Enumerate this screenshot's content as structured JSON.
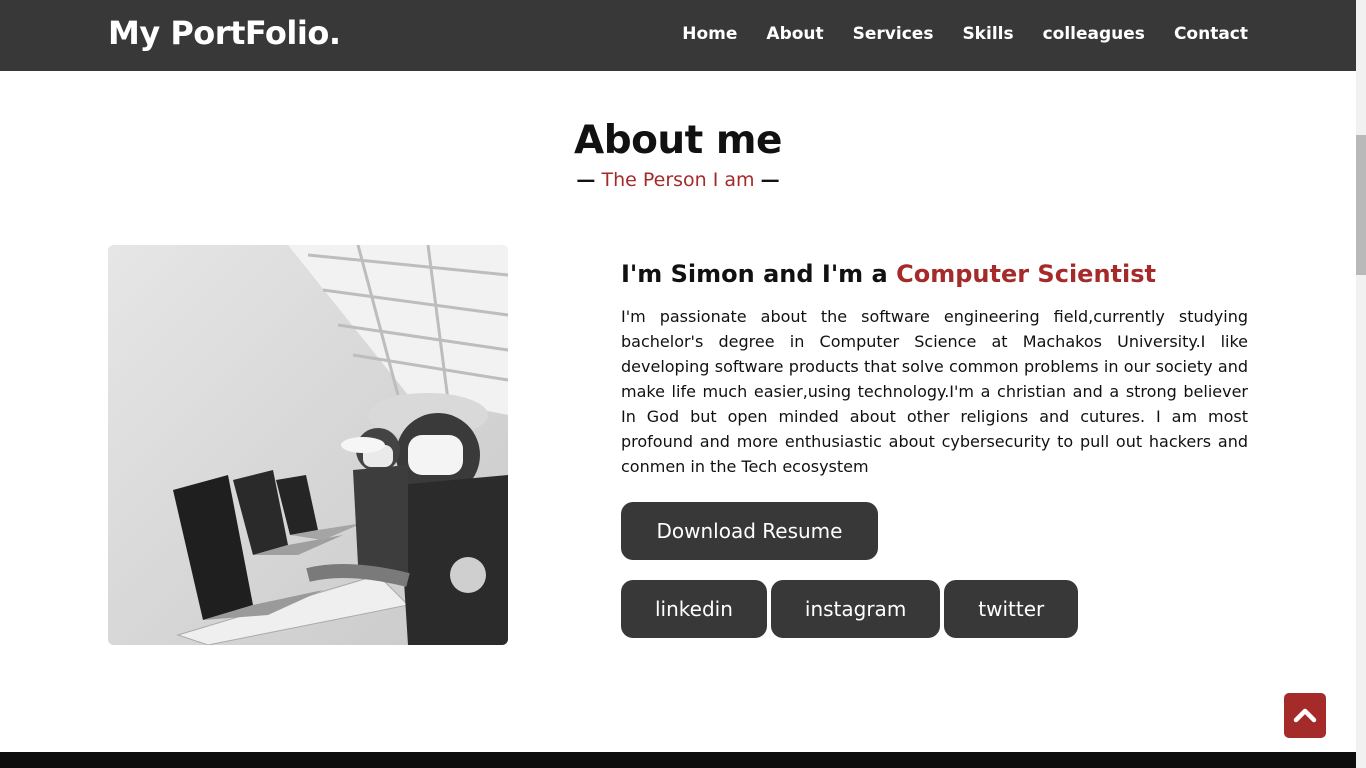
{
  "nav": {
    "logo": "My PortFolio.",
    "items": [
      "Home",
      "About",
      "Services",
      "Skills",
      "colleagues",
      "Contact"
    ]
  },
  "about": {
    "title": "About me",
    "subtitle": "The Person I am",
    "dash": "—",
    "heading_prefix": "I'm Simon and I'm a ",
    "heading_role": "Computer Scientist",
    "paragraph": "I'm passionate about the software engineering field,currently studying bachelor's degree in Computer Science at Machakos University.I like developing software products that solve common problems in our society and make life much easier,using technology.I'm a christian and a strong believer In God but open minded about other religions and cutures. I am most profound and more enthusiastic about cybersecurity to pull out hackers and conmen in the Tech ecosystem",
    "download_label": "Download Resume",
    "social": [
      "linkedin",
      "instagram",
      "twitter"
    ]
  },
  "photo_icon": "photo-image",
  "back_to_top_icon": "chevron-up-icon",
  "colors": {
    "nav_bg": "#383838",
    "accent": "#a52a2a",
    "button_bg": "#383838",
    "footer_bg": "#0d0d0d"
  }
}
